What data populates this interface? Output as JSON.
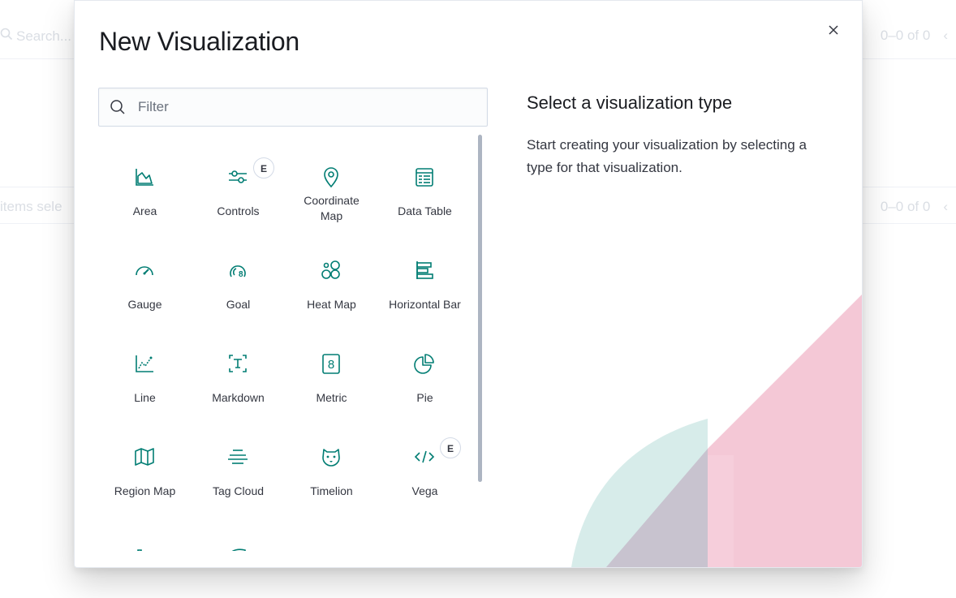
{
  "background": {
    "search_placeholder": "Search...",
    "pager_top": "0–0 of 0",
    "items_selected": "items sele",
    "pager_bottom": "0–0 of 0"
  },
  "modal": {
    "title": "New Visualization",
    "filter_placeholder": "Filter",
    "description_title": "Select a visualization type",
    "description_text": "Start creating your visualization by selecting a type for that visualization.",
    "accent_color": "#017d73",
    "visualizations": [
      {
        "label": "Area",
        "icon": "area-chart-icon",
        "badge": ""
      },
      {
        "label": "Controls",
        "icon": "controls-icon",
        "badge": "E"
      },
      {
        "label": "Coordinate Map",
        "icon": "map-pin-icon",
        "badge": ""
      },
      {
        "label": "Data Table",
        "icon": "data-table-icon",
        "badge": ""
      },
      {
        "label": "Gauge",
        "icon": "gauge-icon",
        "badge": ""
      },
      {
        "label": "Goal",
        "icon": "goal-icon",
        "badge": ""
      },
      {
        "label": "Heat Map",
        "icon": "heat-map-icon",
        "badge": ""
      },
      {
        "label": "Horizontal Bar",
        "icon": "horizontal-bar-icon",
        "badge": ""
      },
      {
        "label": "Line",
        "icon": "line-chart-icon",
        "badge": ""
      },
      {
        "label": "Markdown",
        "icon": "markdown-icon",
        "badge": ""
      },
      {
        "label": "Metric",
        "icon": "metric-icon",
        "badge": ""
      },
      {
        "label": "Pie",
        "icon": "pie-chart-icon",
        "badge": ""
      },
      {
        "label": "Region Map",
        "icon": "region-map-icon",
        "badge": ""
      },
      {
        "label": "Tag Cloud",
        "icon": "tag-cloud-icon",
        "badge": ""
      },
      {
        "label": "Timelion",
        "icon": "timelion-icon",
        "badge": ""
      },
      {
        "label": "Vega",
        "icon": "vega-code-icon",
        "badge": "E"
      },
      {
        "label": "",
        "icon": "vertical-bar-icon",
        "badge": ""
      },
      {
        "label": "",
        "icon": "visual-builder-icon",
        "badge": ""
      }
    ]
  }
}
